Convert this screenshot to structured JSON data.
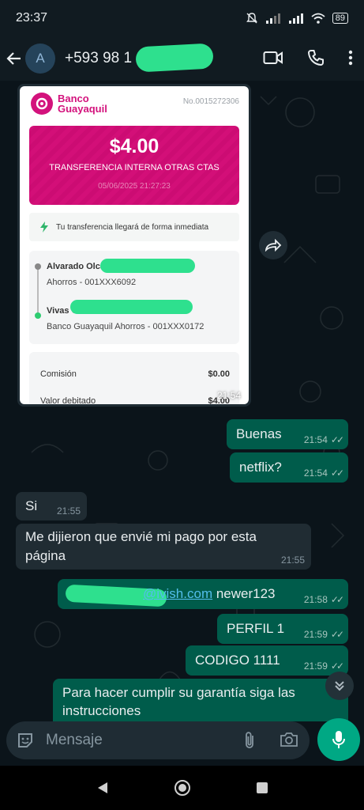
{
  "status_bar": {
    "time": "23:37",
    "battery": "89"
  },
  "header": {
    "avatar_letter": "A",
    "contact": "+593 98 1"
  },
  "receipt": {
    "bank_name_line1": "Banco",
    "bank_name_line2": "Guayaquil",
    "number": "No.0015272306",
    "amount": "$4.00",
    "type": "TRANSFERENCIA INTERNA OTRAS CTAS",
    "date": "05/06/2025 21:27:23",
    "notice": "Tu transferencia llegará de forma inmediata",
    "from_name": "Alvarado Olcas Anais Madeleine",
    "from_account": "Ahorros - 001XXX6092",
    "to_name": "Vivas C",
    "to_account": "Banco Guayaquil Ahorros - 001XXX0172",
    "fee_label": "Comisión",
    "fee_value": "$0.00",
    "debited_label": "Valor debitado",
    "debited_value": "$4.00",
    "time": "21:54"
  },
  "messages": [
    {
      "text": "Buenas",
      "time": "21:54"
    },
    {
      "text": "netflix?",
      "time": "21:54"
    },
    {
      "text": "Si",
      "time": "21:55"
    },
    {
      "line1": "Me dijieron que envié mi pago por esta",
      "line2": "página",
      "time": "21:55"
    },
    {
      "link": "@ivish.com",
      "text": "newer123",
      "time": "21:58"
    },
    {
      "text": "PERFIL 1",
      "time": "21:59"
    },
    {
      "text": "CODIGO 1111",
      "time": "21:59"
    },
    {
      "line1": "Para hacer cumplir su garantía siga las",
      "line2": "instrucciones"
    }
  ],
  "composer": {
    "placeholder": "Mensaje"
  },
  "colors": {
    "outgoing": "#005c4b",
    "incoming": "#202c33",
    "accent": "#00a884",
    "bank": "#d3127c"
  }
}
